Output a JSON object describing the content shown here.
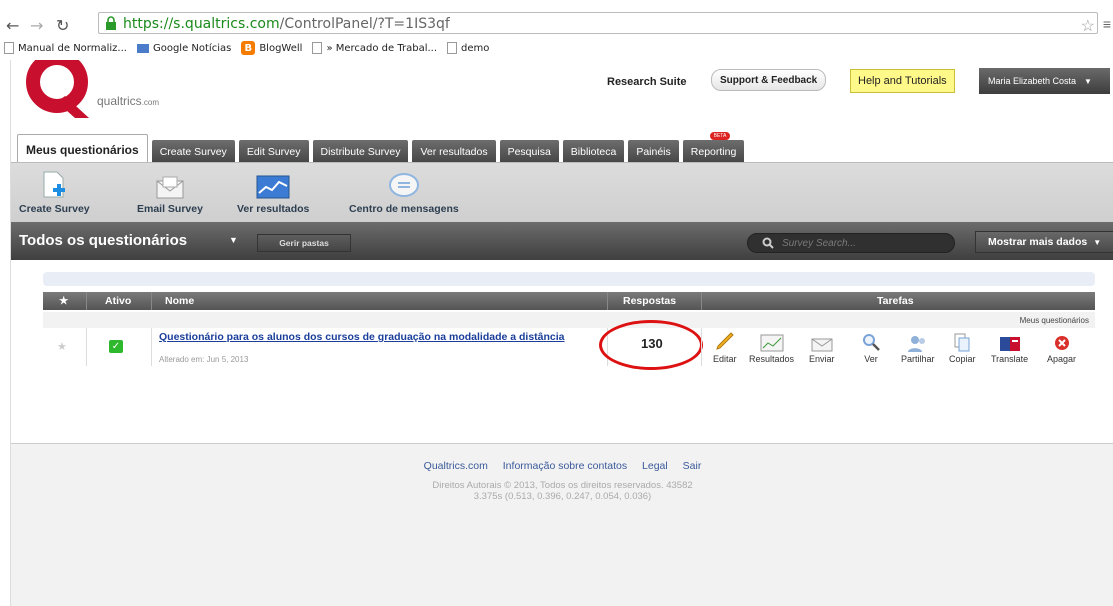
{
  "browser": {
    "url_domain": "https://s.qualtrics.com",
    "url_path": "/ControlPanel/?T=1IS3qf",
    "bookmarks": [
      "Manual de Normaliz...",
      "Google Notícias",
      "BlogWell",
      "» Mercado de Trabal...",
      "demo"
    ]
  },
  "header": {
    "logo_text": "qualtrics",
    "logo_suffix": ".com",
    "research_suite": "Research Suite",
    "support": "Support & Feedback",
    "help": "Help and Tutorials",
    "user": "Maria Elizabeth Costa"
  },
  "tabs": [
    {
      "label": "Meus questionários",
      "active": true
    },
    {
      "label": "Create Survey"
    },
    {
      "label": "Edit Survey"
    },
    {
      "label": "Distribute Survey"
    },
    {
      "label": "Ver resultados"
    },
    {
      "label": "Pesquisa"
    },
    {
      "label": "Biblioteca"
    },
    {
      "label": "Painéis"
    },
    {
      "label": "Reporting",
      "badge": "BETA"
    }
  ],
  "toolbar": [
    {
      "label": "Create Survey",
      "icon": "new-document-icon"
    },
    {
      "label": "Email Survey",
      "icon": "envelope-icon"
    },
    {
      "label": "Ver resultados",
      "icon": "chart-icon"
    },
    {
      "label": "Centro de mensagens",
      "icon": "speech-bubble-icon"
    }
  ],
  "folderbar": {
    "title": "Todos os questionários",
    "manage": "Gerir pastas",
    "search_placeholder": "Survey Search...",
    "more_data": "Mostrar mais dados"
  },
  "table": {
    "headers": {
      "star": "★",
      "ativo": "Ativo",
      "nome": "Nome",
      "respostas": "Respostas",
      "tarefas": "Tarefas"
    },
    "folder_label": "Meus questionários",
    "rows": [
      {
        "name": "Questionário para os alunos dos cursos de graduação na modalidade a distância",
        "modified": "Alterado em: Jun 5, 2013",
        "respostas": "130",
        "active": true
      }
    ],
    "tasks": [
      "Editar",
      "Resultados",
      "Enviar",
      "Ver",
      "Partilhar",
      "Copiar",
      "Translate",
      "Apagar"
    ]
  },
  "footer": {
    "links": [
      "Qualtrics.com",
      "Informação sobre contatos",
      "Legal",
      "Sair"
    ],
    "copyright": "Direitos Autorais © 2013, Todos os direitos reservados. 43582",
    "timing": "3.375s (0.513, 0.396, 0.247, 0.054, 0.036)"
  },
  "colors": {
    "accent_red": "#d11111",
    "link_blue": "#1a3e9a",
    "help_yellow": "#fff98a",
    "check_green": "#2eb82e"
  }
}
